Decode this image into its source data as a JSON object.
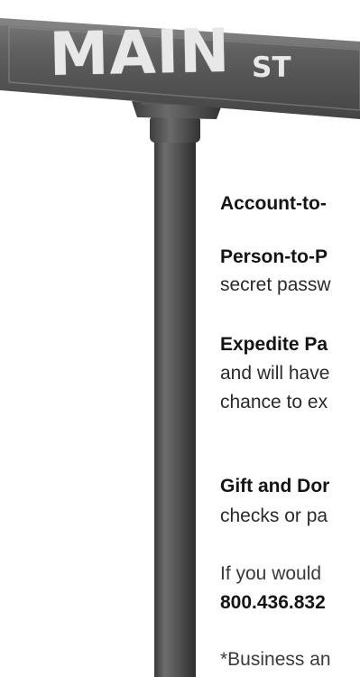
{
  "sign": {
    "street_name": "MAIN",
    "street_suffix": "ST",
    "colors": {
      "sign_plate": "#555555",
      "pole": "#4d4d4d",
      "lettering": "#e8e8e8"
    }
  },
  "content": {
    "account_heading": "Account-to-",
    "p2p_heading": "Person-to-P",
    "p2p_text": "secret passw",
    "expedite_heading": "Expedite Pa",
    "expedite_text_1": "and will have",
    "expedite_text_2": "chance to ex",
    "gift_heading": "Gift and Dor",
    "gift_text": "checks or pa",
    "contact_text": "If you would",
    "phone": "800.436.832",
    "footnote": "*Business an"
  }
}
